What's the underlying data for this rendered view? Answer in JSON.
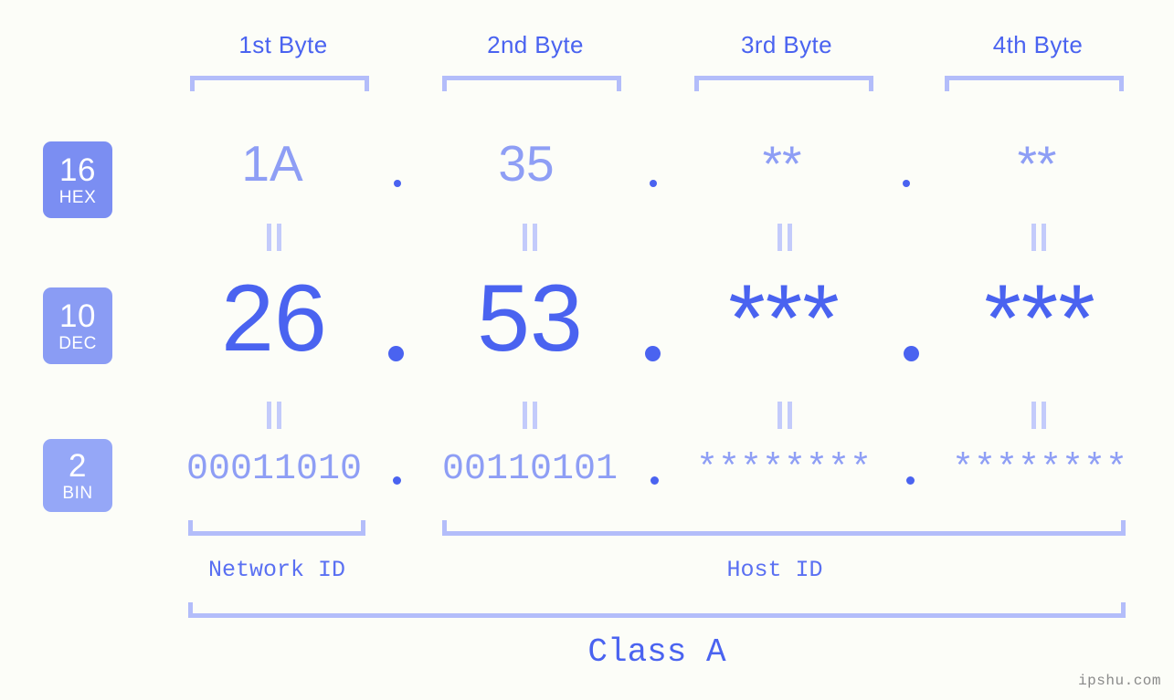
{
  "background_color": "#fcfdf8",
  "colors": {
    "accent_strong": "#4a63f0",
    "accent_light": "#8e9ef5",
    "bracket": "#b3bdfa",
    "equals": "#c3cbfb",
    "badge_hex": "#7b8ef2",
    "badge_dec": "#8a9cf4",
    "badge_bin": "#95a7f7",
    "watermark": "#8a8a8a"
  },
  "byte_headers": [
    {
      "label": "1st Byte"
    },
    {
      "label": "2nd Byte"
    },
    {
      "label": "3rd Byte"
    },
    {
      "label": "4th Byte"
    }
  ],
  "radix_badges": [
    {
      "number": "16",
      "name": "HEX"
    },
    {
      "number": "10",
      "name": "DEC"
    },
    {
      "number": "2",
      "name": "BIN"
    }
  ],
  "rows": {
    "hex": {
      "radix": "16",
      "radix_name": "HEX",
      "values": [
        "1A",
        "35",
        "**",
        "**"
      ]
    },
    "dec": {
      "radix": "10",
      "radix_name": "DEC",
      "values": [
        "26",
        "53",
        "***",
        "***"
      ]
    },
    "bin": {
      "radix": "2",
      "radix_name": "BIN",
      "values": [
        "00011010",
        "00110101",
        "********",
        "********"
      ]
    }
  },
  "separator": ".",
  "equality_symbol": "=",
  "id_labels": [
    {
      "label": "Network ID"
    },
    {
      "label": "Host ID"
    }
  ],
  "class_label": "Class A",
  "watermark": "ipshu.com"
}
